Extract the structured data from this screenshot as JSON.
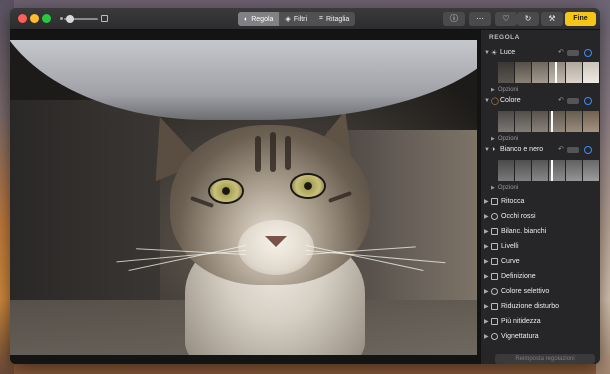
{
  "toolbar": {
    "tabs": [
      {
        "label": "Regola",
        "icon": "adjust-icon",
        "active": true
      },
      {
        "label": "Filtri",
        "icon": "filters-icon",
        "active": false
      },
      {
        "label": "Ritaglia",
        "icon": "crop-icon",
        "active": false
      }
    ],
    "done_label": "Fine",
    "done_color": "#f5c518",
    "buttons": [
      "info-icon",
      "more-icon",
      "heart-icon",
      "rotate-icon",
      "magic-wand-icon"
    ]
  },
  "sidebar": {
    "title": "REGOLA",
    "sections": [
      {
        "label": "Luce",
        "icon": "sun-icon",
        "options_label": "Opzioni"
      },
      {
        "label": "Colore",
        "icon": "color-circle-icon",
        "options_label": "Opzioni"
      },
      {
        "label": "Bianco e nero",
        "icon": "half-circle-icon",
        "options_label": "Opzioni"
      }
    ],
    "tools": [
      {
        "label": "Ritocca",
        "icon": "bandage-icon"
      },
      {
        "label": "Occhi rossi",
        "icon": "eye-icon"
      },
      {
        "label": "Bilanc. bianchi",
        "icon": "white-balance-icon"
      },
      {
        "label": "Livelli",
        "icon": "levels-icon"
      },
      {
        "label": "Curve",
        "icon": "curves-icon"
      },
      {
        "label": "Definizione",
        "icon": "definition-icon"
      },
      {
        "label": "Colore selettivo",
        "icon": "selective-color-icon"
      },
      {
        "label": "Riduzione disturbo",
        "icon": "noise-reduction-icon"
      },
      {
        "label": "Più nitidezza",
        "icon": "sharpen-icon"
      },
      {
        "label": "Vignettatura",
        "icon": "vignette-icon"
      }
    ],
    "reset_label": "Reimposta regolazioni",
    "accent_color": "#3b8cf5"
  }
}
